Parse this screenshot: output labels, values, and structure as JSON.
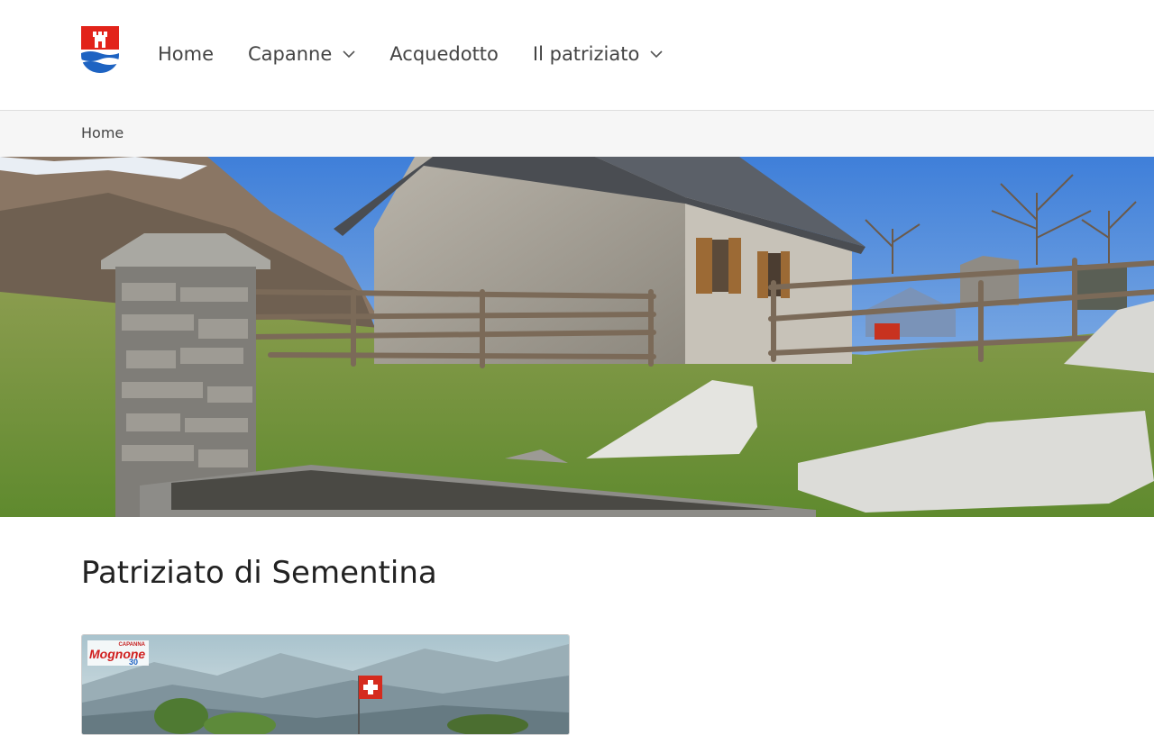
{
  "header": {
    "logo_alt": "Patriziato di Sementina",
    "nav": [
      {
        "label": "Home",
        "has_dropdown": false
      },
      {
        "label": "Capanne",
        "has_dropdown": true
      },
      {
        "label": "Acquedotto",
        "has_dropdown": false
      },
      {
        "label": "Il patriziato",
        "has_dropdown": true
      }
    ]
  },
  "breadcrumb": {
    "items": [
      "Home"
    ]
  },
  "hero": {
    "alt": "Cascina in pietra con fontana e recinto in montagna"
  },
  "main": {
    "title": "Patriziato di Sementina",
    "card": {
      "badge_top": "CAPANNA",
      "badge_main": "Mognone",
      "badge_num": "30"
    }
  },
  "colors": {
    "coat_red": "#e2231a",
    "coat_blue": "#1e63c2",
    "text": "#333333",
    "crumb_bg": "#f6f6f6"
  }
}
